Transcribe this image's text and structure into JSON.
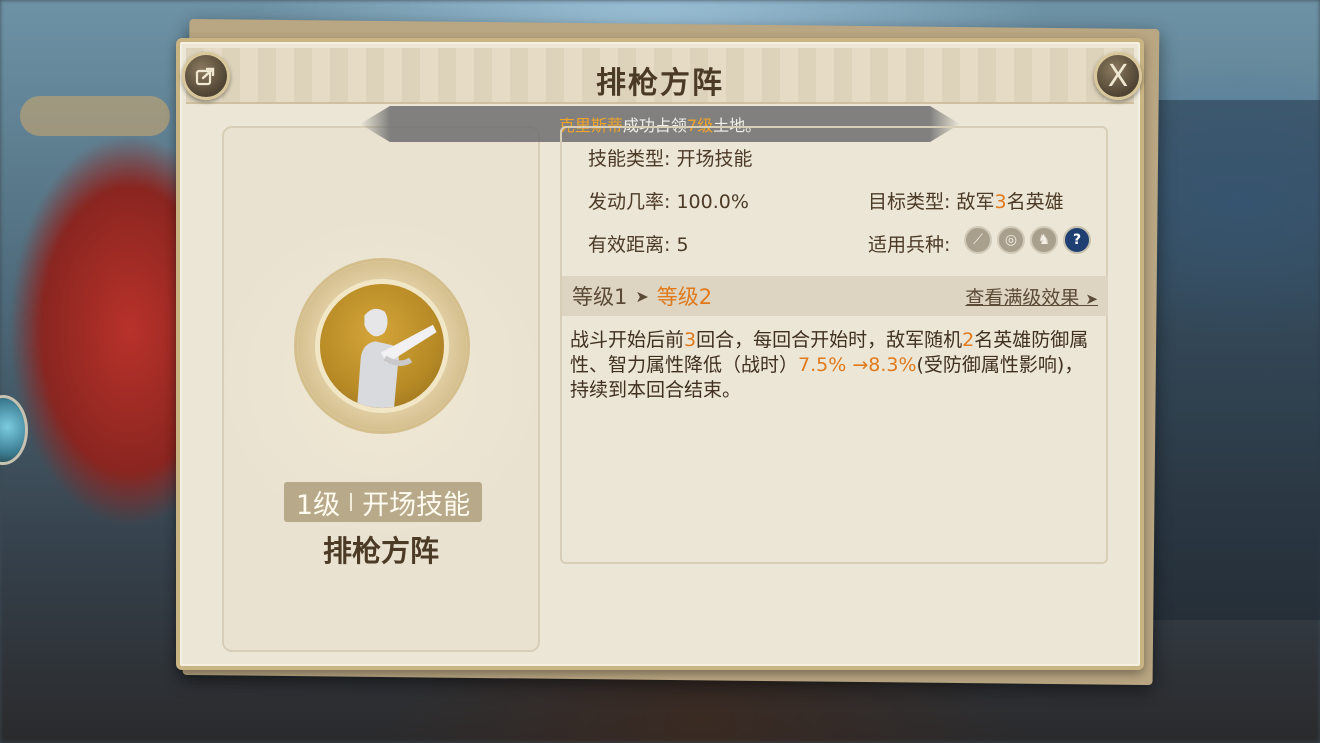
{
  "notice": {
    "name": "克里斯蒂",
    "mid": "成功占领",
    "level": "7级",
    "tail": "土地。"
  },
  "panel": {
    "title": "排枪方阵"
  },
  "share_icon": "share-icon",
  "close_label": "X",
  "skill": {
    "name": "排枪方阵",
    "level": "1级",
    "type_short": "开场技能"
  },
  "attrs": {
    "type_label": "技能类型:",
    "type_value": "开场技能",
    "rate_label": "发动几率:",
    "rate_value": "100.0%",
    "range_label": "有效距离:",
    "range_value": "5",
    "target_label": "目标类型:",
    "target_prefix": "敌军",
    "target_num": "3",
    "target_suffix": "名英雄",
    "troop_label": "适用兵种:",
    "troops": [
      "sword-icon",
      "target-icon",
      "horse-icon",
      "question-icon"
    ],
    "troop_glyphs": [
      "⟋",
      "◎",
      "♞",
      "?"
    ]
  },
  "level_bar": {
    "from": "等级1",
    "arrow": "➤",
    "to": "等级2",
    "view_max": "查看满级效果",
    "view_arrow": "➤"
  },
  "description": {
    "p1": "战斗开始后前",
    "n1": "3",
    "p2": "回合，每回合开始时，敌军随机",
    "n2": "2",
    "p3": "名英雄防御属性、智力属性降低（战时）",
    "n3": "7.5% →8.3%",
    "p4": "(受防御属性影响)，持续到本回合结束。"
  },
  "colors": {
    "accent": "#e07a1c",
    "title": "#4b3a26",
    "panel_bg": "#ece6d6"
  }
}
